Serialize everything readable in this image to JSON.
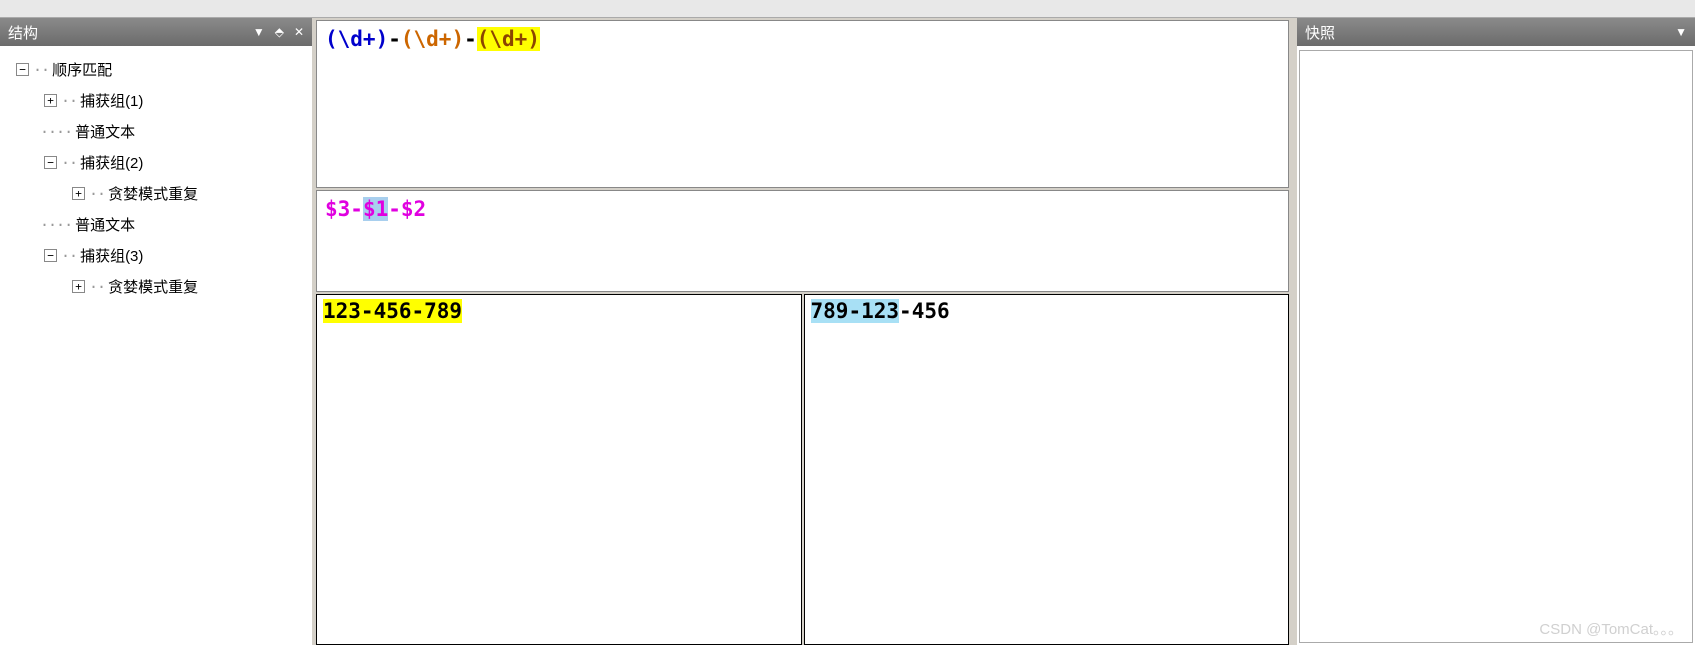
{
  "panels": {
    "structure_title": "结构",
    "snapshot_title": "快照"
  },
  "tree": {
    "root": "顺序匹配",
    "n1": "捕获组(1)",
    "n2": "普通文本",
    "n3": "捕获组(2)",
    "n3_1": "贪婪模式重复",
    "n4": "普通文本",
    "n5": "捕获组(3)",
    "n5_1": "贪婪模式重复"
  },
  "regex": {
    "g1": "(\\d+)",
    "d1": "-",
    "g2": "(\\d+)",
    "d2": "-",
    "g3": "(\\d+)"
  },
  "replace": {
    "p1": "$3",
    "d1": "-",
    "p2": "$1",
    "d2": "-",
    "p3": "$2"
  },
  "input": {
    "full": "123-456-789"
  },
  "output": {
    "p1": "789",
    "d1": "-",
    "p2": "123",
    "d2": "-",
    "p3": "456"
  },
  "watermark": "CSDN @TomCat。。。"
}
